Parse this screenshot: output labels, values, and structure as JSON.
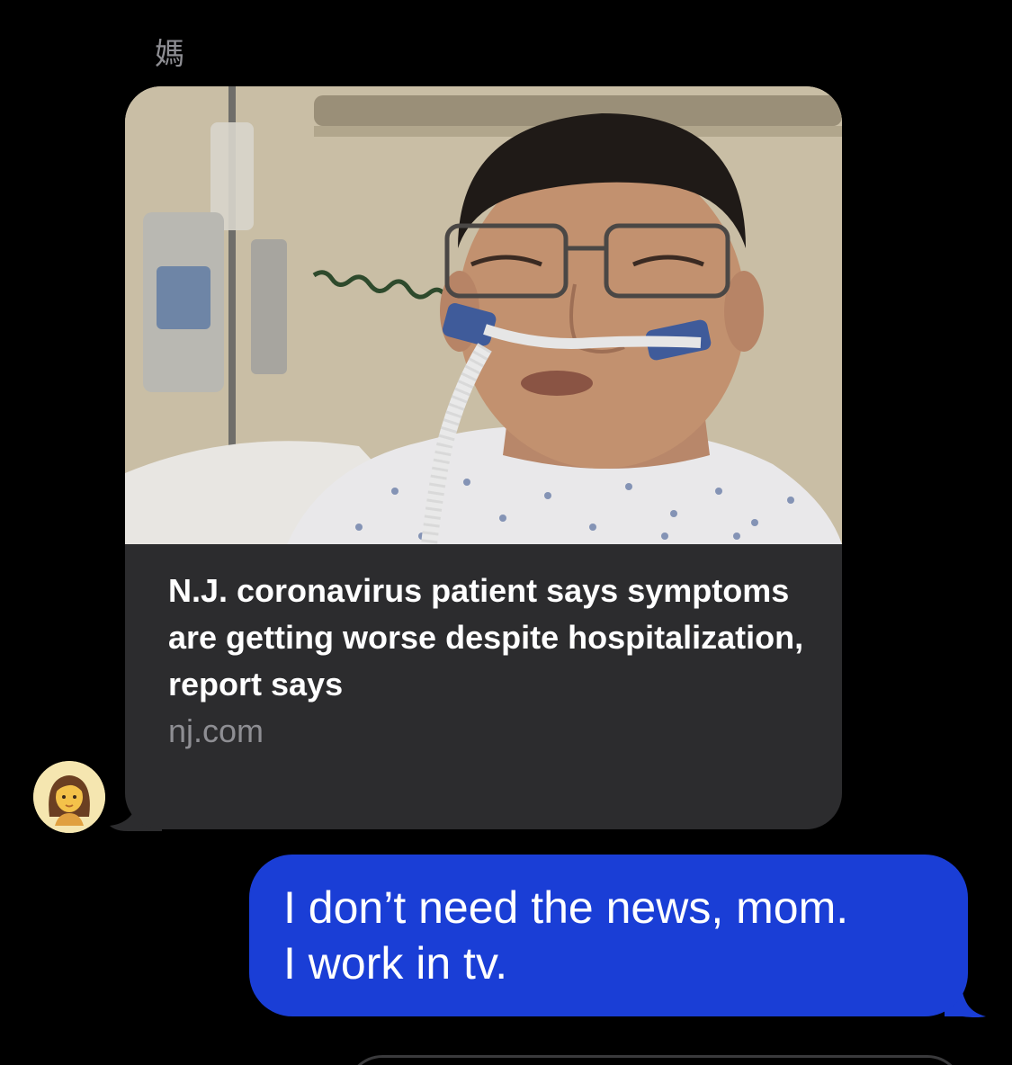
{
  "conversation": {
    "sender_name": "媽"
  },
  "incoming_message": {
    "type": "link-preview",
    "image": "hospital-patient-photo",
    "title": "N.J. coronavirus patient says symptoms are getting worse despite hospitalization, report says",
    "domain": "nj.com",
    "avatar_icon": "woman-emoji-avatar"
  },
  "outgoing_message": {
    "text_line1": "I don’t need the news, mom.",
    "text_line2": "I work in tv.",
    "bubble_color": "#1a3ed6"
  },
  "colors": {
    "background": "#000000",
    "incoming_bubble": "#2c2c2e",
    "secondary_text": "#8e8e93"
  }
}
